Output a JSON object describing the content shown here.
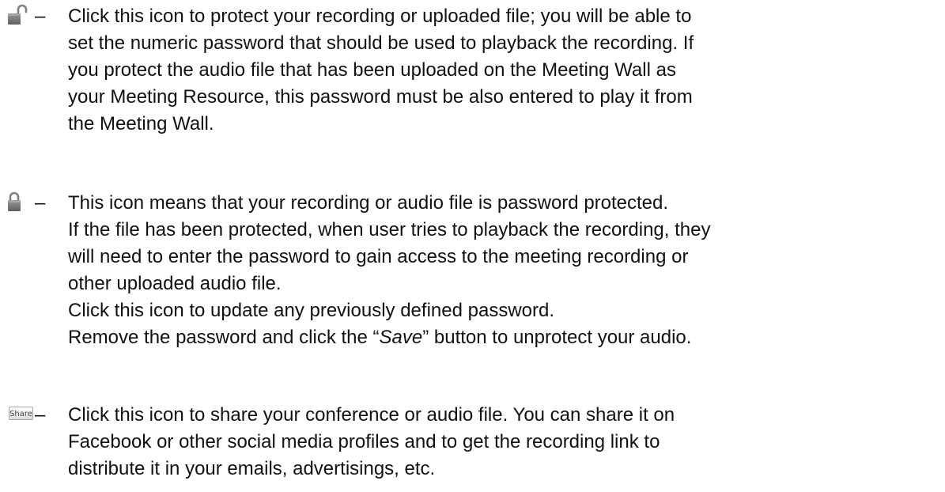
{
  "dash": "–",
  "entries": [
    {
      "icon": "unlock-icon",
      "lines": [
        "Click this icon to protect your recording or uploaded file; you will be able to",
        "set the numeric password that should be used to playback the recording. If",
        "you protect the audio file that has been uploaded on the Meeting Wall as",
        "your Meeting Resource, this password must be also entered to play it from",
        "the Meeting Wall."
      ]
    },
    {
      "icon": "lock-icon",
      "lines": [
        "This icon means that your recording or audio file is password protected.",
        "If the file has been protected, when user tries to playback the recording, they",
        "will need to enter the password to gain access to the meeting recording or",
        "other uploaded audio file.",
        "Click this icon to update any previously defined password."
      ],
      "last_line": {
        "before": "Remove the password and click the “",
        "emphasis": "Save",
        "after": "” button to unprotect your audio."
      }
    },
    {
      "icon": "share-button",
      "button_label": "Share",
      "lines": [
        "Click this icon to share your conference or audio file. You can share it on",
        "Facebook or other social media profiles and to get the recording link to",
        "distribute it in your emails, advertisings, etc."
      ]
    }
  ]
}
